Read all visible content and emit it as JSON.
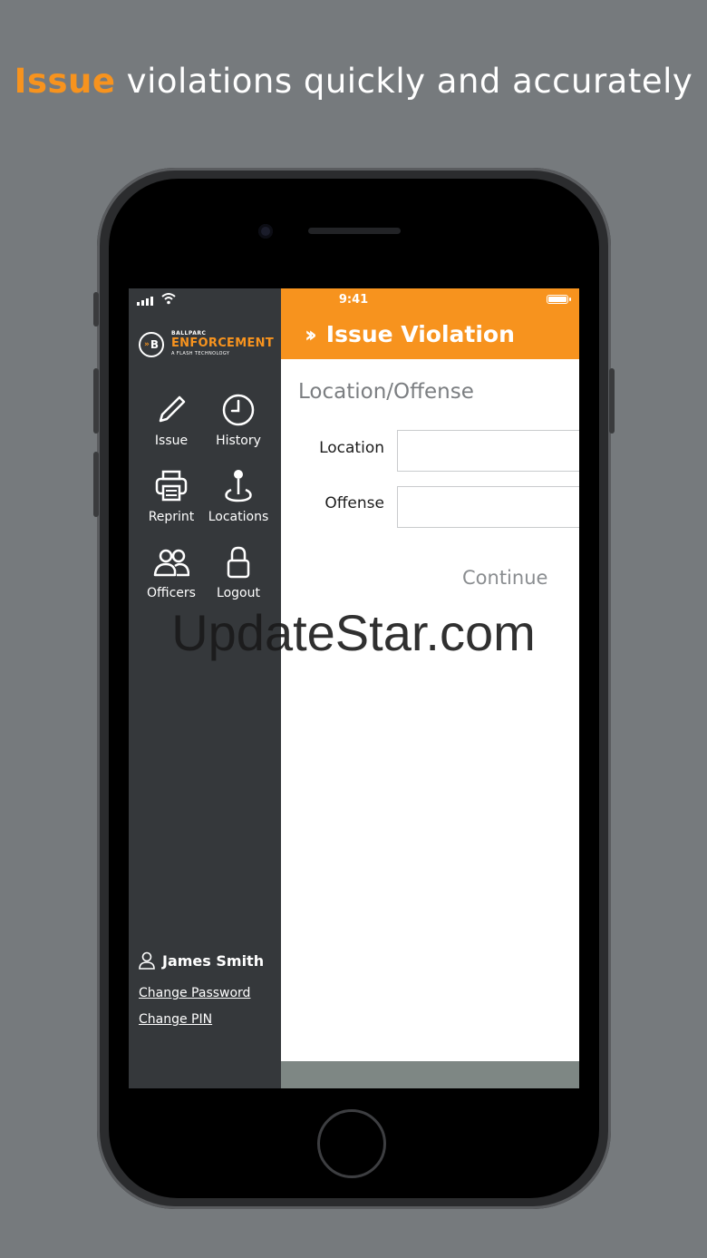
{
  "headline": {
    "accent": "Issue",
    "rest": " violations quickly and accurately"
  },
  "status": {
    "time": "9:41"
  },
  "logo": {
    "badge": "B",
    "top": "BALLPARC",
    "main": "ENFORCEMENT",
    "sub": "A FLASH TECHNOLOGY"
  },
  "nav": [
    {
      "label": "Issue",
      "icon": "pencil-icon"
    },
    {
      "label": "History",
      "icon": "clock-icon"
    },
    {
      "label": "Reprint",
      "icon": "printer-icon"
    },
    {
      "label": "Locations",
      "icon": "location-pin-icon"
    },
    {
      "label": "Officers",
      "icon": "users-icon"
    },
    {
      "label": "Logout",
      "icon": "lock-icon"
    }
  ],
  "user": {
    "name": "James Smith",
    "change_password": "Change Password",
    "change_pin": "Change PIN"
  },
  "header": {
    "title": "Issue Violation"
  },
  "form": {
    "section_title": "Location/Offense",
    "location_label": "Location",
    "location_value": "",
    "offense_label": "Offense",
    "offense_value": "",
    "continue_label": "Continue"
  },
  "watermark": "UpdateStar.com",
  "colors": {
    "accent": "#f7931e",
    "sidebar": "#35383b",
    "background": "#767a7d"
  }
}
